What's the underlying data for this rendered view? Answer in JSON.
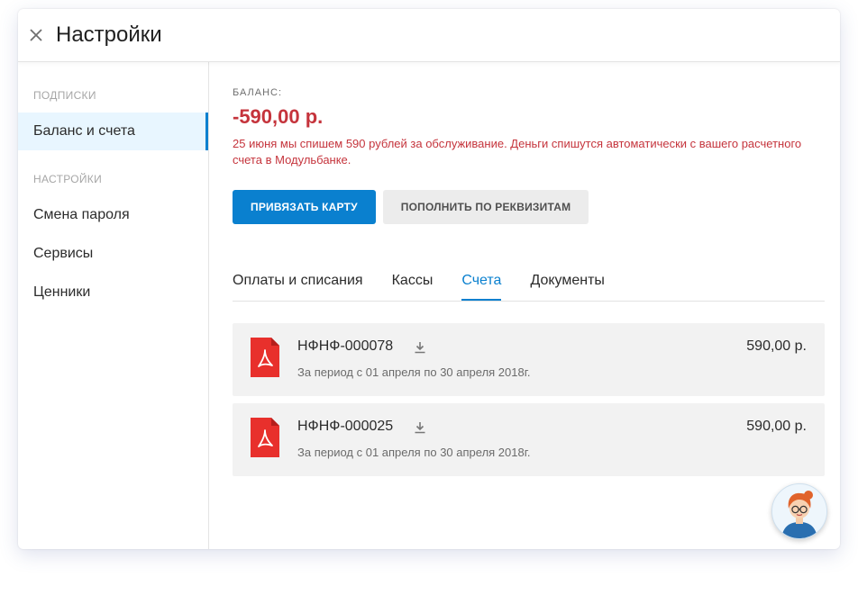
{
  "header": {
    "title": "Настройки"
  },
  "sidebar": {
    "sections": [
      {
        "title": "ПОДПИСКИ",
        "items": [
          {
            "label": "Баланс и счета"
          }
        ]
      },
      {
        "title": "НАСТРОЙКИ",
        "items": [
          {
            "label": "Смена пароля"
          },
          {
            "label": "Сервисы"
          },
          {
            "label": "Ценники"
          }
        ]
      }
    ]
  },
  "balance": {
    "label": "БАЛАНС:",
    "amount": "-590,00 р.",
    "note": "25 июня мы спишем 590 рублей за обслуживание. Деньги спишутся автоматически с вашего расчетного счета в Модульбанке."
  },
  "buttons": {
    "bind_card": "ПРИВЯЗАТЬ КАРТУ",
    "top_up": "ПОПОЛНИТЬ ПО РЕКВИЗИТАМ"
  },
  "tabs": [
    {
      "label": "Оплаты и списания"
    },
    {
      "label": "Кассы"
    },
    {
      "label": "Счета",
      "active": true
    },
    {
      "label": "Документы"
    }
  ],
  "invoices": [
    {
      "number": "НФНФ-000078",
      "period": "За период с 01 апреля по 30 апреля 2018г.",
      "amount": "590,00 р."
    },
    {
      "number": "НФНФ-000025",
      "period": "За период с 01 апреля по 30 апреля 2018г.",
      "amount": "590,00 р."
    }
  ],
  "colors": {
    "accent": "#0a80cf",
    "negative": "#c5343c",
    "pdf": "#e8302c"
  },
  "icons": {
    "close": "close-icon",
    "pdf": "pdf-file-icon",
    "download": "download-icon",
    "assistant": "assistant-avatar"
  }
}
